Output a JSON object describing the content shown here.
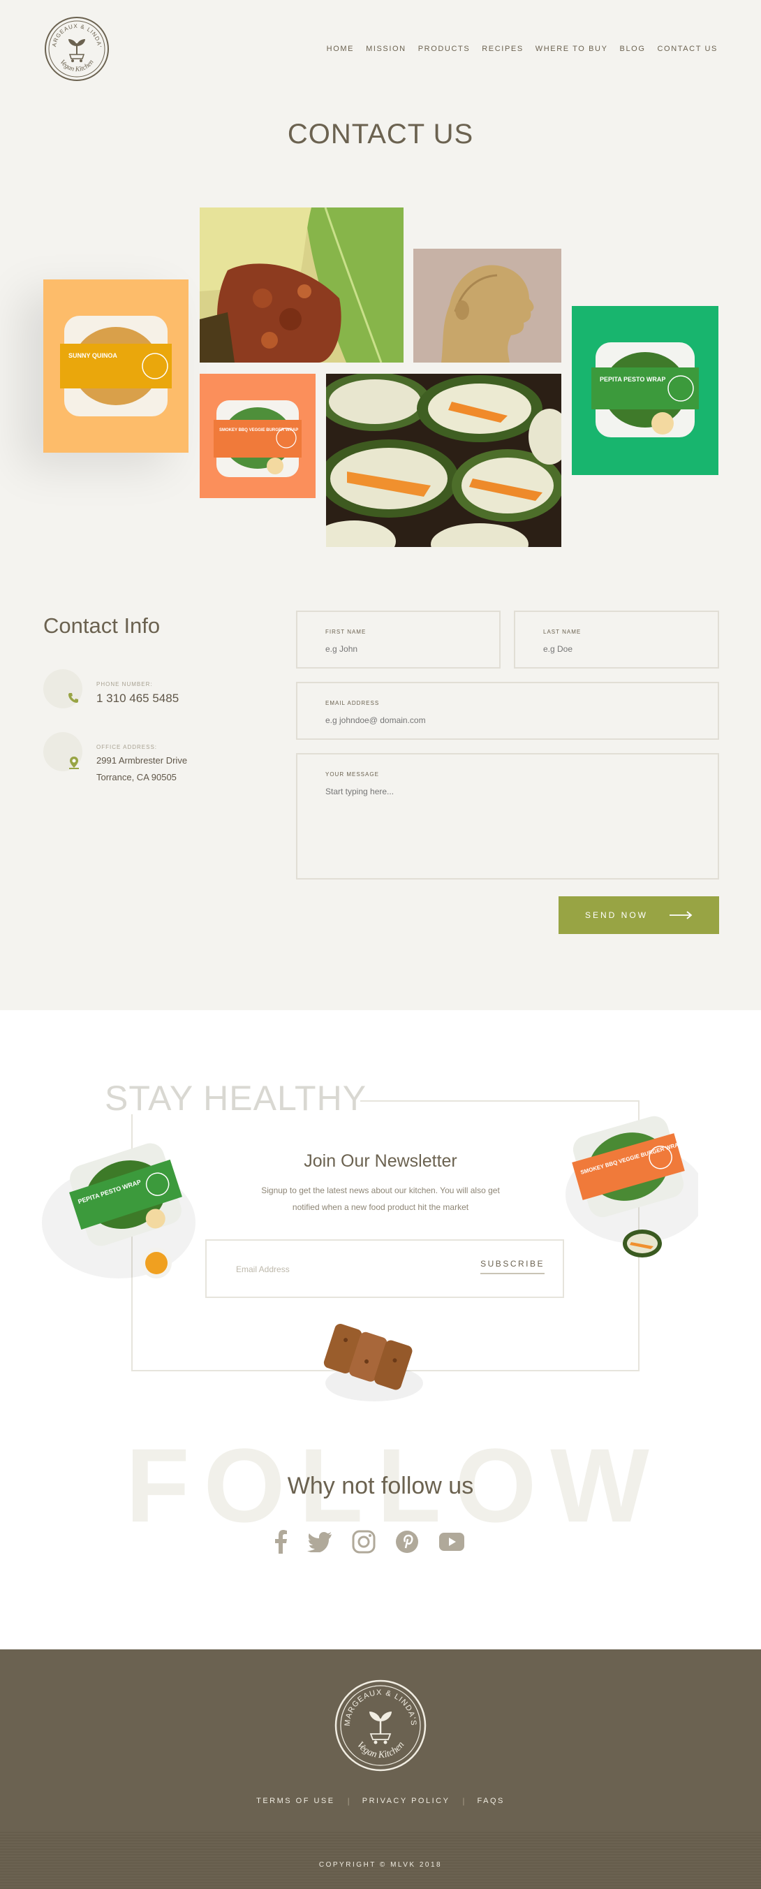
{
  "brand": {
    "logo_top": "MARGEAUX & LINDA'S",
    "logo_bottom": "Vegan Kitchen"
  },
  "nav": {
    "items": [
      "HOME",
      "MISSION",
      "PRODUCTS",
      "RECIPES",
      "WHERE TO BUY",
      "BLOG",
      "CONTACT US"
    ]
  },
  "page": {
    "title": "CONTACT US"
  },
  "products": {
    "yellow": "SUNNY QUINOA",
    "orange": "SMOKEY BBQ VEGGIE BURGER WRAP",
    "green": "PEPITA PESTO WRAP"
  },
  "contact_info": {
    "title": "Contact Info",
    "phone_label": "PHONE NUMBER:",
    "phone": "1 310 465 5485",
    "address_label": "OFFICE ADDRESS:",
    "address_line1": "2991 Armbrester Drive",
    "address_line2": "Torrance, CA 90505"
  },
  "form": {
    "first_name_label": "FIRST NAME",
    "first_name_placeholder": "e.g John",
    "last_name_label": "LAST NAME",
    "last_name_placeholder": "e.g Doe",
    "email_label": "EMAIL ADDRESS",
    "email_placeholder": "e.g johndoe@ domain.com",
    "message_label": "YOUR MESSAGE",
    "message_placeholder": "Start typing here...",
    "send_label": "SEND NOW"
  },
  "newsletter": {
    "stay": "STAY HEALTHY",
    "title": "Join Our Newsletter",
    "subtitle": "Signup to get the latest news about our kitchen. You will also get notified when a new food product hit the market",
    "email_placeholder": "Email Address",
    "subscribe_label": "SUBSCRIBE"
  },
  "follow": {
    "bg_word": "FOLLOW",
    "title": "Why not follow us",
    "icons": [
      "facebook-icon",
      "twitter-icon",
      "instagram-icon",
      "pinterest-icon",
      "youtube-icon"
    ]
  },
  "footer": {
    "links": [
      "TERMS OF USE",
      "PRIVACY POLICY",
      "FAQS"
    ],
    "copyright": "COPYRIGHT © MLVK 2018"
  },
  "colors": {
    "olive": "#98a444",
    "brown": "#6b6251",
    "background": "#f4f3ef",
    "orange": "#fb8f5b",
    "green": "#18b56e",
    "yellow": "#fdbc6a"
  }
}
